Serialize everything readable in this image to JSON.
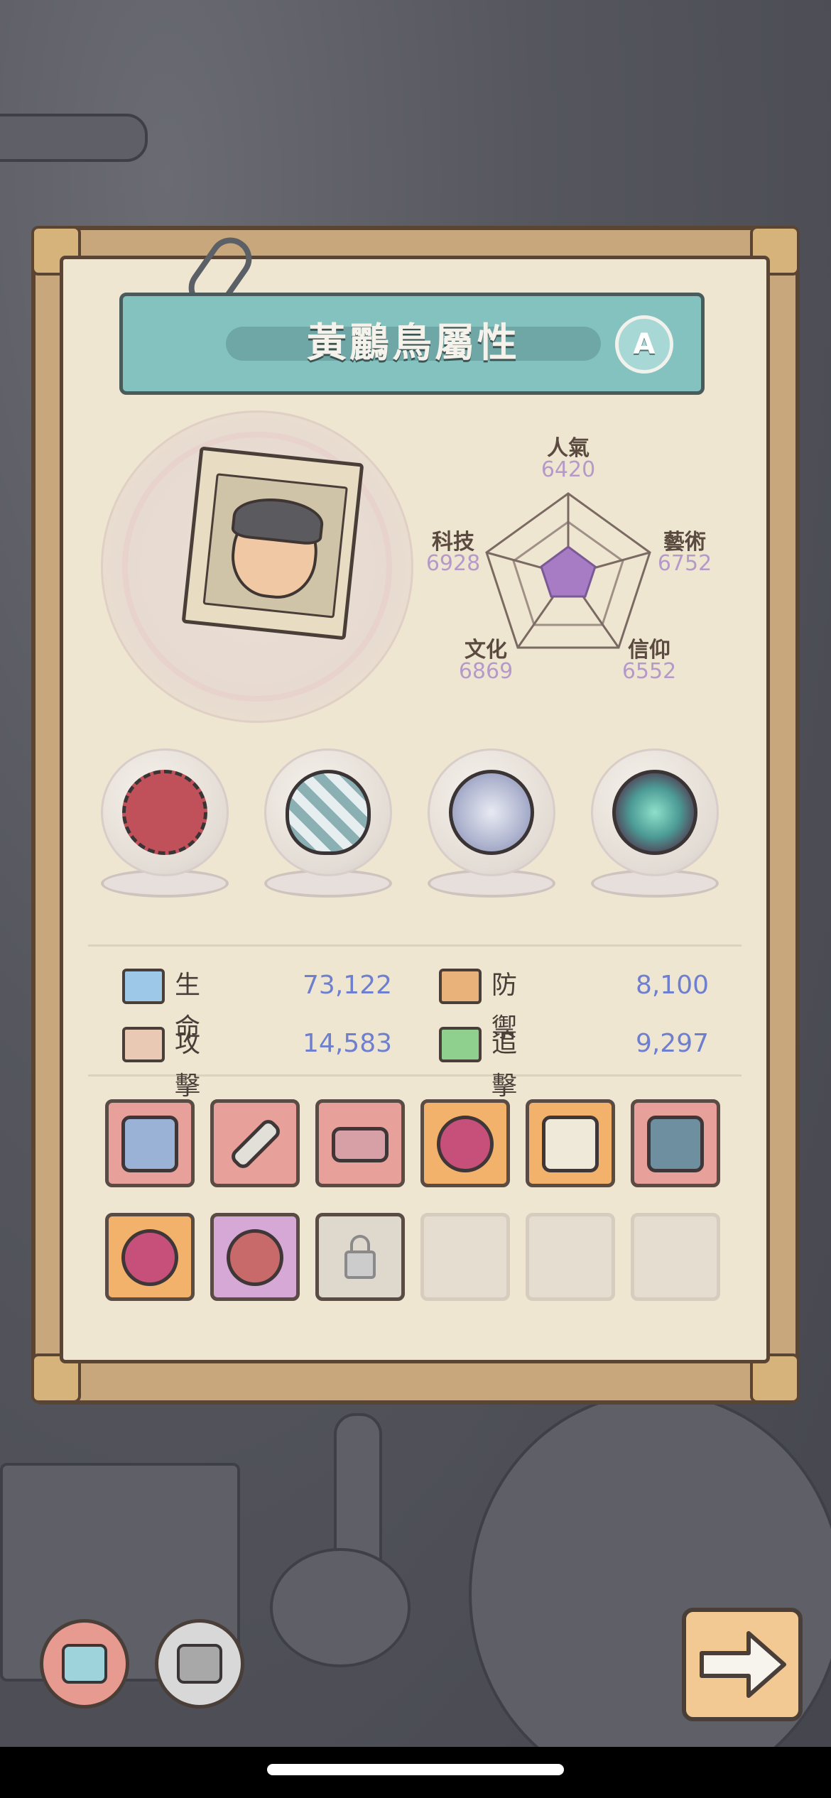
{
  "title": "黃鸝鳥屬性",
  "grade": "A",
  "radar": {
    "popularity": {
      "label": "人氣",
      "value": "6420"
    },
    "arts": {
      "label": "藝術",
      "value": "6752"
    },
    "faith": {
      "label": "信仰",
      "value": "6552"
    },
    "culture": {
      "label": "文化",
      "value": "6869"
    },
    "tech": {
      "label": "科技",
      "value": "6928"
    }
  },
  "stats": {
    "hp": {
      "label": "生命",
      "value": "73,122"
    },
    "defense": {
      "label": "防禦",
      "value": "8,100"
    },
    "attack": {
      "label": "攻擊",
      "value": "14,583"
    },
    "pursuit": {
      "label": "追擊",
      "value": "9,297"
    }
  },
  "colors": {
    "stat_value": "#6f7fcf",
    "radar_value": "#b59ac8",
    "title_bar": "#84c2c0"
  },
  "equipment": [
    "thorn-wreath-icon",
    "checkered-shell-icon",
    "compass-icon",
    "portal-ring-icon"
  ],
  "skill_slots": [
    {
      "icon": "mech-gun-icon",
      "color": "red"
    },
    {
      "icon": "dagger-icon",
      "color": "red"
    },
    {
      "icon": "bracelet-icon",
      "color": "red"
    },
    {
      "icon": "wing-orb-icon",
      "color": "orange"
    },
    {
      "icon": "crossed-swords-icon",
      "color": "orange"
    },
    {
      "icon": "dragon-head-icon",
      "color": "red"
    },
    {
      "icon": "wing-orb-icon",
      "color": "orange"
    },
    {
      "icon": "chain-weight-icon",
      "color": "purple"
    },
    {
      "icon": "lock-icon",
      "color": "locked"
    },
    {
      "icon": "",
      "color": "empty"
    },
    {
      "icon": "",
      "color": "empty"
    },
    {
      "icon": "",
      "color": "empty"
    }
  ]
}
